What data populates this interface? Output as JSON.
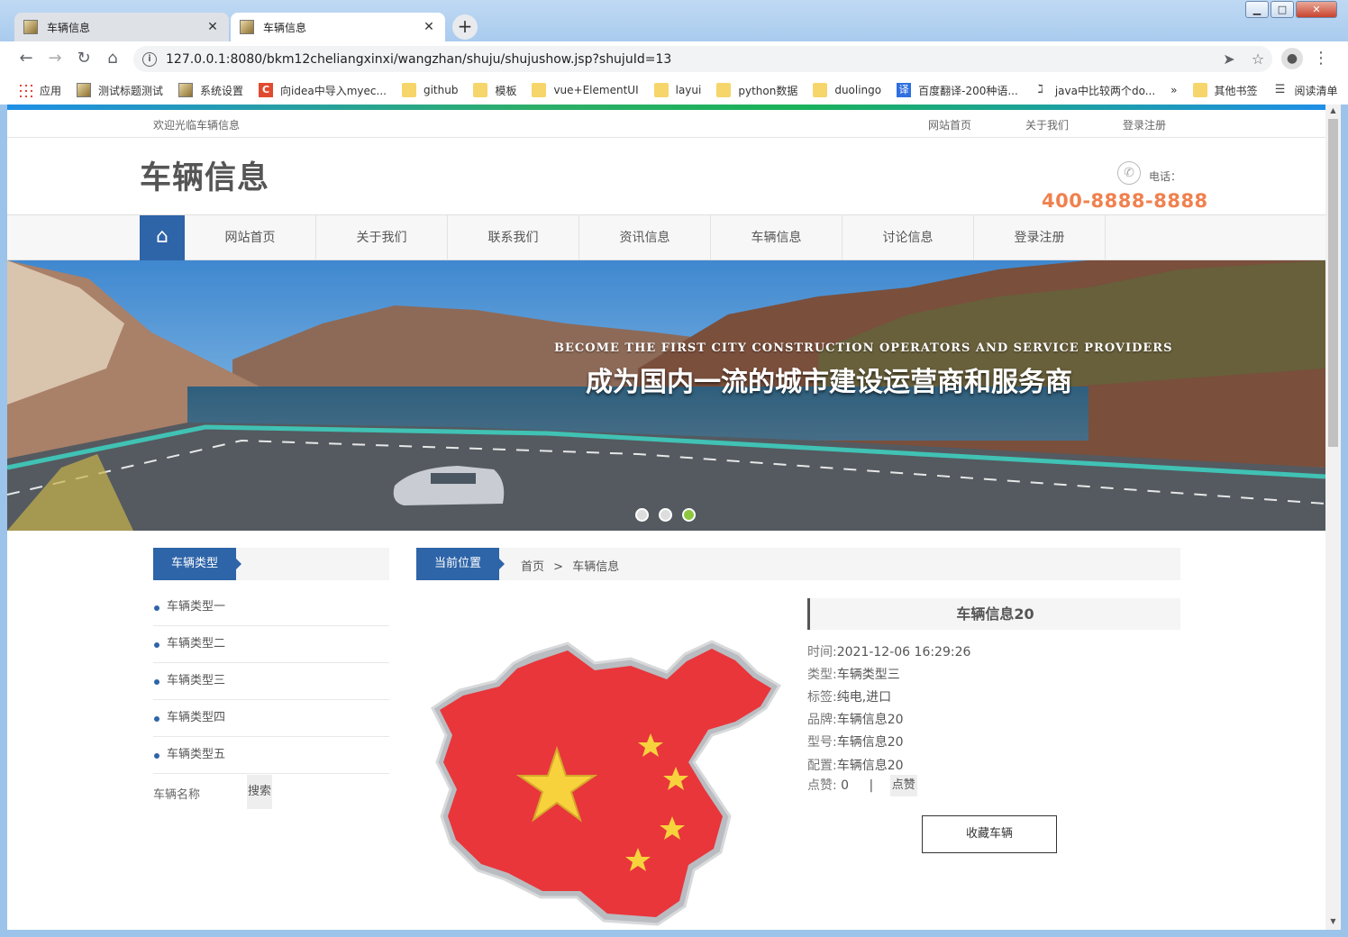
{
  "browser": {
    "tabs": [
      {
        "title": "车辆信息",
        "close": "✕"
      },
      {
        "title": "车辆信息",
        "close": "✕"
      }
    ],
    "new_tab": "+",
    "window_controls": {
      "minimize": "▁",
      "maximize": "□",
      "close": "✕"
    },
    "url": "127.0.0.1:8080/bkm12cheliangxinxi/wangzhan/shuju/shujushow.jsp?shujuId=13",
    "bookmarks": [
      {
        "label": "应用",
        "icon": "apps-grid-icon"
      },
      {
        "label": "测试标题测试",
        "icon": "page-icon"
      },
      {
        "label": "系统设置",
        "icon": "page-icon"
      },
      {
        "label": "向idea中导入myec...",
        "icon": "csdn-icon",
        "glyph": "C"
      },
      {
        "label": "github",
        "icon": "folder-icon"
      },
      {
        "label": "模板",
        "icon": "folder-icon"
      },
      {
        "label": "vue+ElementUI",
        "icon": "folder-icon"
      },
      {
        "label": "layui",
        "icon": "folder-icon"
      },
      {
        "label": "python数据",
        "icon": "folder-icon"
      },
      {
        "label": "duolingo",
        "icon": "folder-icon"
      },
      {
        "label": "百度翻译-200种语...",
        "icon": "translate-icon",
        "glyph": "译"
      },
      {
        "label": "java中比较两个do...",
        "icon": "baidu-icon",
        "glyph": "ℷ"
      }
    ],
    "bookmarks_overflow": "»",
    "other_bookmarks": "其他书签",
    "reading_list": "阅读清单"
  },
  "site": {
    "welcome": "欢迎光临车辆信息",
    "top_links": [
      "网站首页",
      "关于我们",
      "登录注册"
    ],
    "logo": "车辆信息",
    "phone_label": "电话：",
    "phone_number": "400-8888-8888",
    "nav": [
      "网站首页",
      "关于我们",
      "联系我们",
      "资讯信息",
      "车辆信息",
      "讨论信息",
      "登录注册"
    ],
    "banner": {
      "en": "BECOME THE FIRST CITY CONSTRUCTION OPERATORS AND SERVICE PROVIDERS",
      "cn": "成为国内一流的城市建设运营商和服务商",
      "slide_count": 3,
      "active_slide": 3
    }
  },
  "sidebar": {
    "title": "车辆类型",
    "categories": [
      "车辆类型一",
      "车辆类型二",
      "车辆类型三",
      "车辆类型四",
      "车辆类型五"
    ],
    "search_label": "车辆名称",
    "search_button": "搜索"
  },
  "breadcrumb": {
    "label": "当前位置",
    "home": "首页",
    "sep": ">",
    "current": "车辆信息"
  },
  "detail": {
    "title": "车辆信息20",
    "fields": [
      {
        "key": "时间:",
        "value": "2021-12-06 16:29:26"
      },
      {
        "key": "类型:",
        "value": "车辆类型三"
      },
      {
        "key": "标签:",
        "value": "纯电,进口"
      },
      {
        "key": "品牌:",
        "value": "车辆信息20"
      },
      {
        "key": "型号:",
        "value": "车辆信息20"
      },
      {
        "key": "配置:",
        "value": "车辆信息20"
      }
    ],
    "likes_label": "点赞:",
    "likes_count": "0",
    "likes_sep": "|",
    "like_button": "点赞",
    "favorite_button": "收藏车辆"
  },
  "colors": {
    "brand_blue": "#2e64a8",
    "phone_orange": "#f0814f",
    "active_dot": "#8dc63f"
  }
}
